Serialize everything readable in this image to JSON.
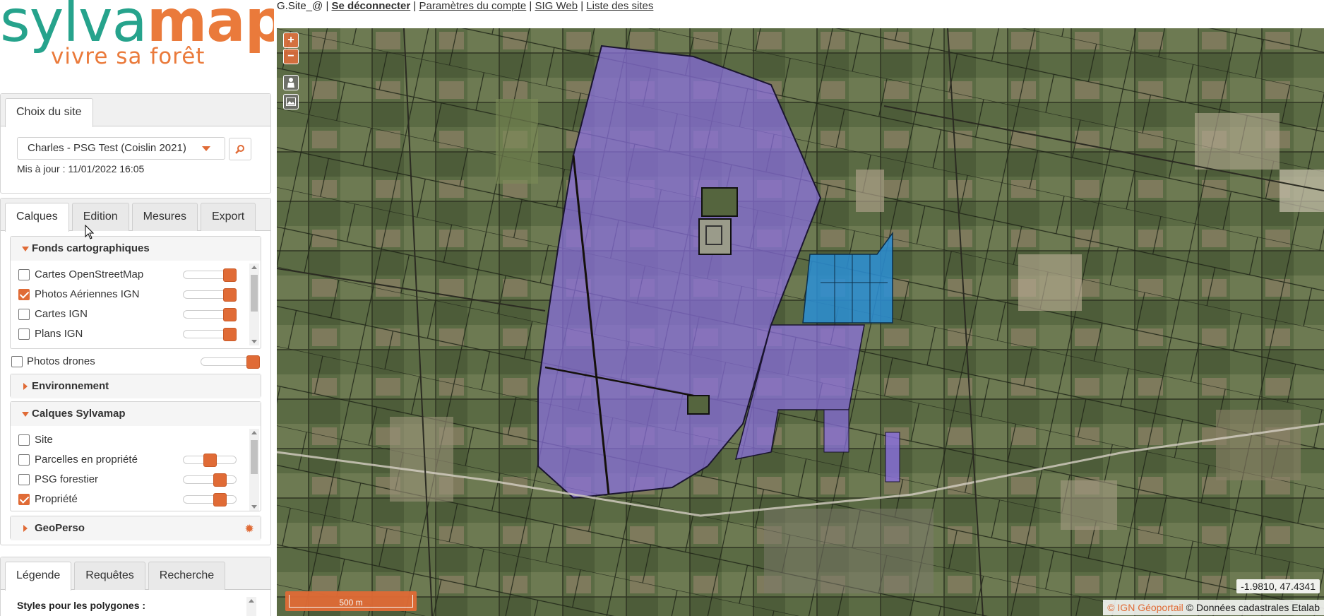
{
  "logo": {
    "text_main_a": "sylva",
    "text_main_b": "map",
    "text_sub": "vivre sa forêt"
  },
  "top_links": {
    "user": "G.Site_@",
    "logout": "Se déconnecter",
    "account": "Paramètres du compte",
    "sig": "SIG Web",
    "sites": "Liste des sites",
    "sep": "|"
  },
  "site_panel": {
    "tab": "Choix du site",
    "selected_site": "Charles - PSG Test (Coislin 2021)",
    "updated": "Mis à jour : 11/01/2022 16:05"
  },
  "layers_panel": {
    "tabs": [
      "Calques",
      "Edition",
      "Mesures",
      "Export"
    ],
    "fonds": {
      "title": "Fonds cartographiques",
      "items": [
        {
          "label": "Cartes OpenStreetMap",
          "checked": false,
          "opacity": 1.0
        },
        {
          "label": "Photos Aériennes IGN",
          "checked": true,
          "opacity": 1.0
        },
        {
          "label": "Cartes IGN",
          "checked": false,
          "opacity": 1.0
        },
        {
          "label": "Plans IGN",
          "checked": false,
          "opacity": 1.0
        }
      ]
    },
    "drones": {
      "label": "Photos drones",
      "checked": false,
      "opacity": 1.0
    },
    "environnement": {
      "title": "Environnement"
    },
    "sylvamap": {
      "title": "Calques Sylvamap",
      "items": [
        {
          "label": "Site",
          "checked": false,
          "opacity": null
        },
        {
          "label": "Parcelles en propriété",
          "checked": false,
          "opacity": 0.55
        },
        {
          "label": "PSG forestier",
          "checked": false,
          "opacity": 0.7
        },
        {
          "label": "Propriété",
          "checked": true,
          "opacity": 0.7
        }
      ]
    },
    "geoperso": {
      "title": "GeoPerso"
    }
  },
  "bottom_panel": {
    "tabs": [
      "Légende",
      "Requêtes",
      "Recherche"
    ],
    "legend_title": "Styles pour les polygones :"
  },
  "map": {
    "zoom_in": "+",
    "zoom_out": "−",
    "scale": "500 m",
    "coords": "-1.9810, 47.4341",
    "attribution_ign": "© IGN Géoportail",
    "attribution_cad": "© Données cadastrales Etalab"
  },
  "colors": {
    "accent": "#e06b36",
    "teal": "#26a38c",
    "property": "#8a6fe0",
    "psg": "#2c8fd6"
  }
}
